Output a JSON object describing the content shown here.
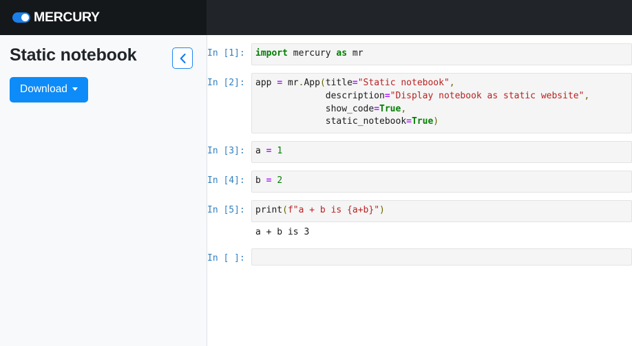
{
  "navbar": {
    "logo_text": "MERCURY",
    "logo_icon": "toggle-switch-icon"
  },
  "sidebar": {
    "title": "Static notebook",
    "collapse_button": {
      "icon": "chevron-left-icon",
      "label": "‹"
    },
    "download_button": {
      "label": "Download",
      "caret_icon": "caret-down-icon"
    },
    "background_color": "#f8f9fa",
    "accent_color": "#0d8bf8"
  },
  "notebook": {
    "cells": [
      {
        "prompt": "In [1]:",
        "type": "code",
        "source": "import mercury as mr",
        "tokens": [
          {
            "t": "import",
            "c": "tok-kw"
          },
          {
            "t": " mercury ",
            "c": "tok-name"
          },
          {
            "t": "as",
            "c": "tok-kw"
          },
          {
            "t": " mr",
            "c": "tok-name"
          }
        ],
        "output": null
      },
      {
        "prompt": "In [2]:",
        "type": "code",
        "source": "app = mr.App(title=\"Static notebook\",\n             description=\"Display notebook as static website\",\n             show_code=True,\n             static_notebook=True)",
        "tokens": [
          {
            "t": "app ",
            "c": "tok-name"
          },
          {
            "t": "=",
            "c": "tok-op"
          },
          {
            "t": " mr",
            "c": "tok-name"
          },
          {
            "t": ".",
            "c": "tok-punct"
          },
          {
            "t": "App",
            "c": "tok-fn"
          },
          {
            "t": "(",
            "c": "tok-punct"
          },
          {
            "t": "title",
            "c": "tok-name"
          },
          {
            "t": "=",
            "c": "tok-op"
          },
          {
            "t": "\"Static notebook\"",
            "c": "tok-str"
          },
          {
            "t": ",",
            "c": "tok-punct"
          },
          {
            "t": "\n             description",
            "c": "tok-name"
          },
          {
            "t": "=",
            "c": "tok-op"
          },
          {
            "t": "\"Display notebook as static website\"",
            "c": "tok-str"
          },
          {
            "t": ",",
            "c": "tok-punct"
          },
          {
            "t": "\n             show_code",
            "c": "tok-name"
          },
          {
            "t": "=",
            "c": "tok-op"
          },
          {
            "t": "True",
            "c": "tok-kw"
          },
          {
            "t": ",",
            "c": "tok-punct"
          },
          {
            "t": "\n             static_notebook",
            "c": "tok-name"
          },
          {
            "t": "=",
            "c": "tok-op"
          },
          {
            "t": "True",
            "c": "tok-kw"
          },
          {
            "t": ")",
            "c": "tok-punct"
          }
        ],
        "output": null
      },
      {
        "prompt": "In [3]:",
        "type": "code",
        "source": "a = 1",
        "tokens": [
          {
            "t": "a ",
            "c": "tok-name"
          },
          {
            "t": "=",
            "c": "tok-op"
          },
          {
            "t": " ",
            "c": "tok-name"
          },
          {
            "t": "1",
            "c": "tok-num"
          }
        ],
        "output": null
      },
      {
        "prompt": "In [4]:",
        "type": "code",
        "source": "b = 2",
        "tokens": [
          {
            "t": "b ",
            "c": "tok-name"
          },
          {
            "t": "=",
            "c": "tok-op"
          },
          {
            "t": " ",
            "c": "tok-name"
          },
          {
            "t": "2",
            "c": "tok-num"
          }
        ],
        "output": null
      },
      {
        "prompt": "In [5]:",
        "type": "code",
        "source": "print(f\"a + b is {a+b}\")",
        "tokens": [
          {
            "t": "print",
            "c": "tok-fn"
          },
          {
            "t": "(",
            "c": "tok-punct"
          },
          {
            "t": "f\"a + b is {a+b}\"",
            "c": "tok-str"
          },
          {
            "t": ")",
            "c": "tok-punct"
          }
        ],
        "output": "a + b is 3"
      },
      {
        "prompt": "In [ ]:",
        "type": "code",
        "source": "",
        "tokens": [],
        "output": null
      }
    ]
  }
}
